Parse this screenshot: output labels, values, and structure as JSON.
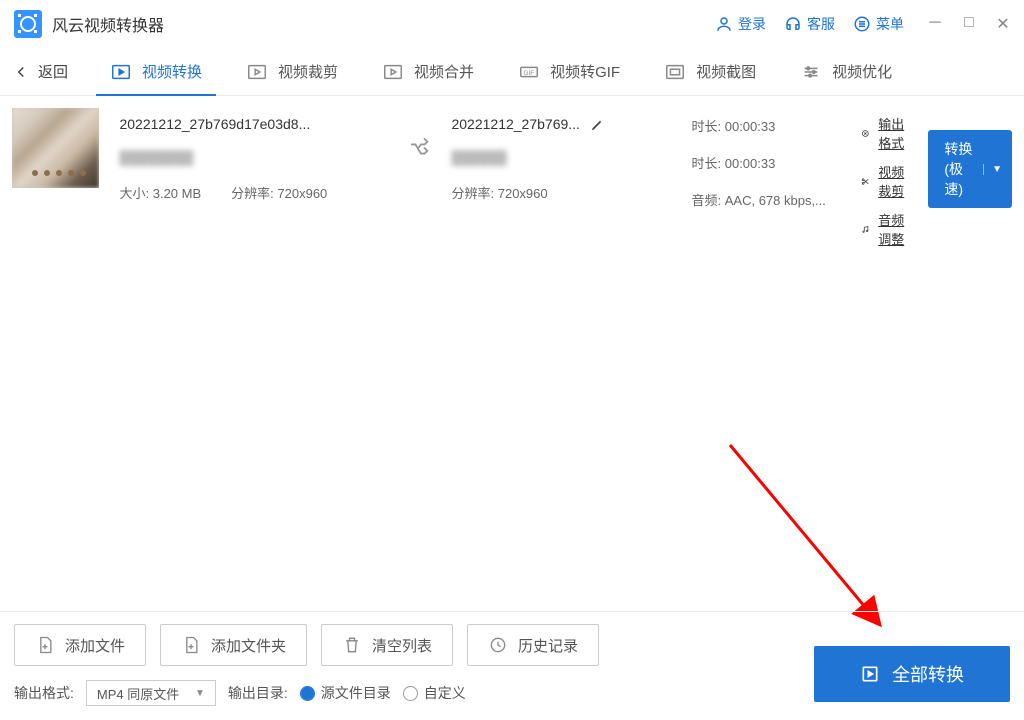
{
  "app": {
    "title": "风云视频转换器"
  },
  "titlebar": {
    "login": "登录",
    "support": "客服",
    "menu": "菜单"
  },
  "toolbar": {
    "back": "返回",
    "tabs": {
      "convert": "视频转换",
      "crop": "视频裁剪",
      "merge": "视频合并",
      "gif": "视频转GIF",
      "screenshot": "视频截图",
      "optimize": "视频优化"
    }
  },
  "file": {
    "name": "20221212_27b769d17e03d8...",
    "duration_label": "时长:",
    "duration": "00:00:33",
    "size_label": "大小:",
    "size": "3.20 MB",
    "res_label": "分辨率:",
    "res": "720x960",
    "out_name": "20221212_27b769...",
    "audio_label": "音频:",
    "audio": "AAC, 678 kbps,..."
  },
  "actions": {
    "output_format": "输出格式",
    "video_crop": "视频裁剪",
    "audio_adjust": "音频调整",
    "convert_quick": "转换(极速)"
  },
  "footer": {
    "add_file": "添加文件",
    "add_folder": "添加文件夹",
    "clear_list": "清空列表",
    "history": "历史记录",
    "output_format_label": "输出格式:",
    "output_format_value": "MP4 同原文件",
    "output_dir_label": "输出目录:",
    "radio_src": "源文件目录",
    "radio_custom": "自定义",
    "convert_all": "全部转换"
  }
}
